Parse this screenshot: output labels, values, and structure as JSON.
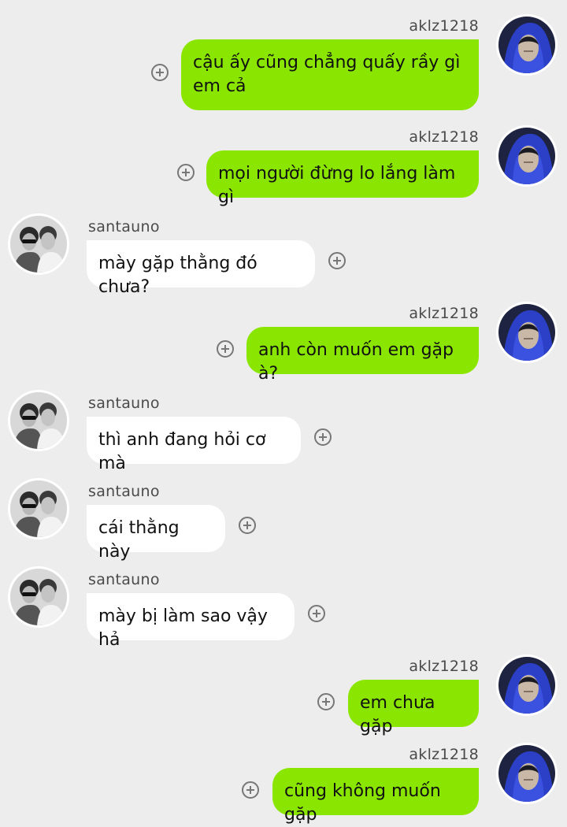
{
  "colors": {
    "background": "#ededed",
    "my_bubble": "#8ae600",
    "their_bubble": "#ffffff"
  },
  "messages": [
    {
      "sender": "aklz1218",
      "text": "cậu ấy cũng chẳng quấy rầy gì\nem cả",
      "side": "me"
    },
    {
      "sender": "aklz1218",
      "text": "mọi người đừng lo lắng làm gì",
      "side": "me"
    },
    {
      "sender": "santauno",
      "text": "mày gặp thằng đó chưa?",
      "side": "other"
    },
    {
      "sender": "aklz1218",
      "text": "anh còn muốn em gặp à?",
      "side": "me"
    },
    {
      "sender": "santauno",
      "text": "thì anh đang hỏi cơ mà",
      "side": "other"
    },
    {
      "sender": "santauno",
      "text": "cái thằng này",
      "side": "other"
    },
    {
      "sender": "santauno",
      "text": "mày bị làm sao vậy hả",
      "side": "other"
    },
    {
      "sender": "aklz1218",
      "text": "em chưa gặp",
      "side": "me"
    },
    {
      "sender": "aklz1218",
      "text": "cũng không muốn gặp",
      "side": "me"
    }
  ],
  "icons": {
    "add_reaction": "plus-circle-icon",
    "my_avatar": "hooded-person-avatar",
    "their_avatar": "two-people-avatar"
  }
}
